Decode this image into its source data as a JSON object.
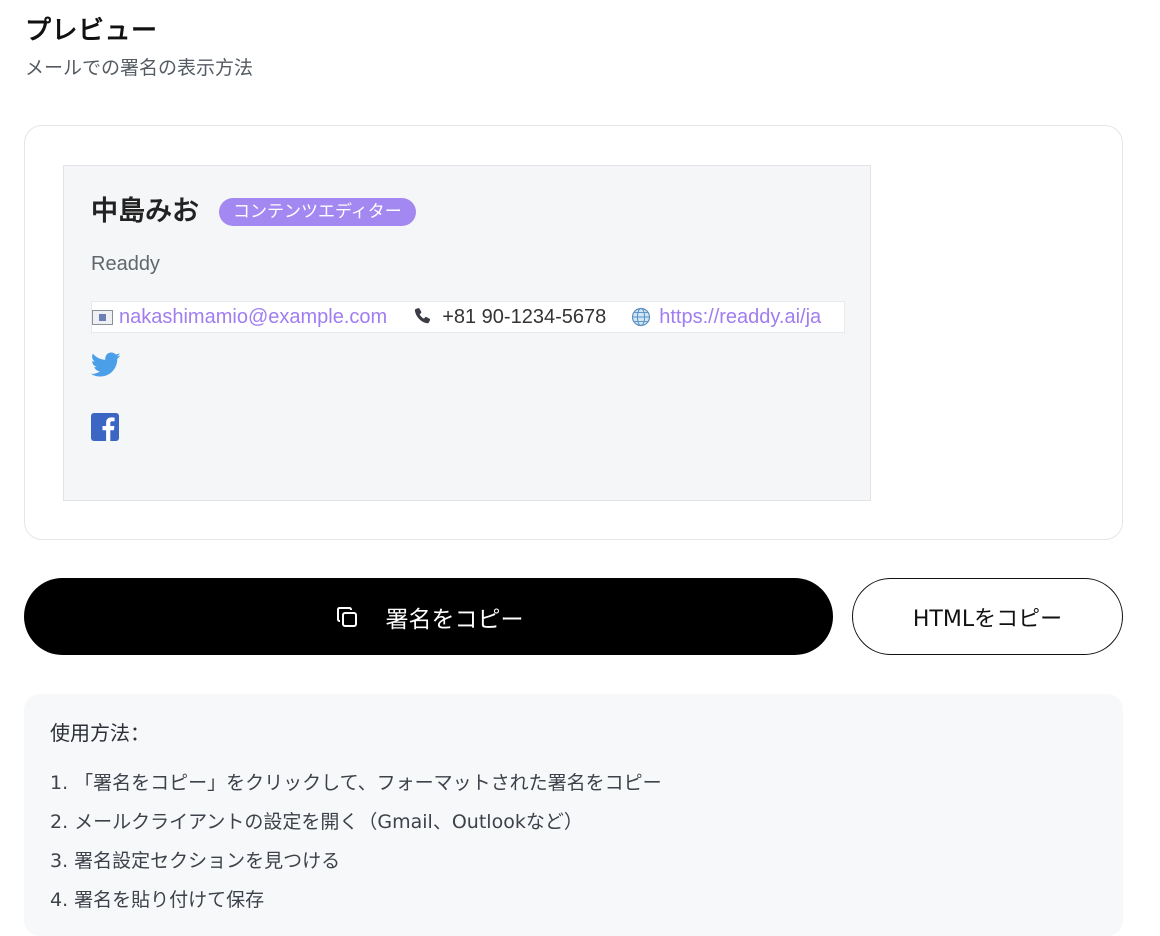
{
  "header": {
    "title": "プレビュー",
    "subtitle": "メールでの署名の表示方法"
  },
  "signature": {
    "name": "中島みお",
    "role_badge": "コンテンツエディター",
    "company": "Readdy",
    "email": "nakashimamio@example.com",
    "phone": "+81 90-1234-5678",
    "website": "https://readdy.ai/ja",
    "icons": {
      "email": "mail-icon",
      "phone": "phone-icon",
      "website": "globe-icon",
      "twitter": "twitter-icon",
      "facebook": "facebook-icon"
    }
  },
  "actions": {
    "copy_signature": "署名をコピー",
    "copy_html": "HTMLをコピー"
  },
  "instructions": {
    "title": "使用方法：",
    "steps": [
      "1. 「署名をコピー」をクリックして、フォーマットされた署名をコピー",
      "2. メールクライアントの設定を開く（Gmail、Outlookなど）",
      "3. 署名設定セクションを見つける",
      "4. 署名を貼り付けて保存"
    ]
  },
  "colors": {
    "badge": "#a488f2",
    "link": "#a07df0",
    "twitter": "#4a9fe8",
    "facebook": "#3b66c4",
    "primary_button": "#000000"
  }
}
